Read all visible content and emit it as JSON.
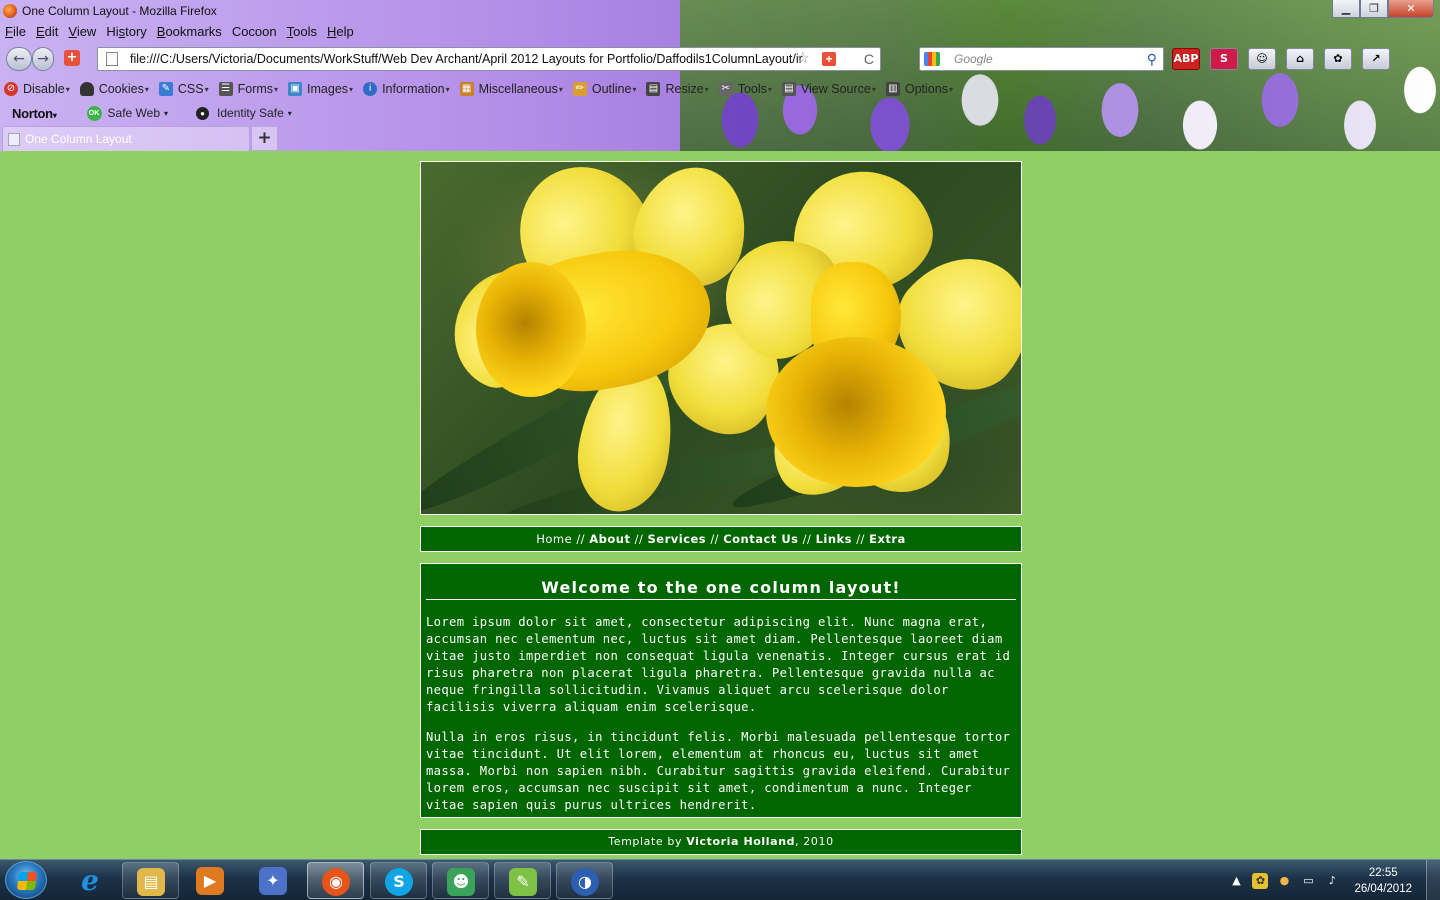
{
  "window": {
    "title": "One Column Layout - Mozilla Firefox",
    "minimize_label": "▁",
    "maximize_label": "❐",
    "close_label": "✕"
  },
  "menubar": {
    "items": [
      {
        "key": "F",
        "rest": "ile"
      },
      {
        "key": "E",
        "rest": "dit"
      },
      {
        "key": "V",
        "rest": "iew"
      },
      {
        "key": "",
        "rest": "Hi",
        "key2": "s",
        "rest2": "tory"
      },
      {
        "key": "B",
        "rest": "ookmarks"
      },
      {
        "key": "",
        "rest": "Cocoon"
      },
      {
        "key": "T",
        "rest": "ools"
      },
      {
        "key": "H",
        "rest": "elp"
      }
    ]
  },
  "navbar": {
    "back_glyph": "←",
    "forward_glyph": "→",
    "url": "file:///C:/Users/Victoria/Documents/WorkStuff/Web Dev Archant/April 2012 Layouts for Portfolio/Daffodils1ColumnLayout/ir",
    "search_placeholder": "Google",
    "star_glyph": "☆",
    "reload_glyph": "C",
    "search_glyph": "⚲",
    "toolbar_icons": [
      "ABP",
      "S",
      "☺",
      "⌂",
      "✿",
      "↗"
    ]
  },
  "webdeveloper_toolbar": {
    "items": [
      {
        "label": "Disable",
        "icon": "disable-icon",
        "color": "#d9342b"
      },
      {
        "label": "Cookies",
        "icon": "cookies-icon",
        "color": "#333333"
      },
      {
        "label": "CSS",
        "icon": "css-icon",
        "color": "#3a7bd5"
      },
      {
        "label": "Forms",
        "icon": "forms-icon",
        "color": "#555555"
      },
      {
        "label": "Images",
        "icon": "images-icon",
        "color": "#3c87c7"
      },
      {
        "label": "Information",
        "icon": "information-icon",
        "color": "#2e6cc6"
      },
      {
        "label": "Miscellaneous",
        "icon": "miscellaneous-icon",
        "color": "#c9822a"
      },
      {
        "label": "Outline",
        "icon": "outline-icon",
        "color": "#d8a030"
      },
      {
        "label": "Resize",
        "icon": "resize-icon",
        "color": "#444444"
      },
      {
        "label": "Tools",
        "icon": "tools-icon",
        "color": "#666666"
      },
      {
        "label": "View Source",
        "icon": "view-source-icon",
        "color": "#555555"
      },
      {
        "label": "Options",
        "icon": "options-icon",
        "color": "#444444"
      }
    ]
  },
  "norton_toolbar": {
    "brand": "Norton",
    "safe_web": "Safe Web",
    "ok_badge": "OK",
    "identity_safe": "Identity Safe"
  },
  "tabs": [
    {
      "label": "One Column Layout"
    }
  ],
  "new_tab_label": "+",
  "page": {
    "nav": {
      "home": "Home",
      "about": "About",
      "services": "Services",
      "contact": "Contact Us",
      "links": "Links",
      "extra": "Extra",
      "separator": "//"
    },
    "heading": "Welcome to the one column layout!",
    "paragraphs": [
      "Lorem ipsum dolor sit amet, consectetur adipiscing elit. Nunc magna erat, accumsan nec elementum nec, luctus sit amet diam. Pellentesque laoreet diam vitae justo imperdiet non consequat ligula venenatis. Integer cursus erat id risus pharetra non placerat ligula pharetra. Pellentesque gravida nulla ac neque fringilla sollicitudin. Vivamus aliquet arcu scelerisque dolor facilisis viverra aliquam enim scelerisque.",
      "Nulla in eros risus, in tincidunt felis. Morbi malesuada pellentesque tortor vitae tincidunt. Ut elit lorem, elementum at rhoncus eu, luctus sit amet massa. Morbi non sapien nibh. Curabitur sagittis gravida eleifend. Curabitur lorem eros, accumsan nec suscipit sit amet, condimentum a nunc. Integer vitae sapien quis purus ultrices hendrerit."
    ],
    "footer": {
      "prefix": "Template by",
      "author": "Victoria Holland",
      "suffix": ", 2010"
    }
  },
  "taskbar": {
    "apps": [
      {
        "name": "internet-explorer",
        "glyph": "e",
        "color": "#1f8fe0"
      },
      {
        "name": "windows-explorer",
        "glyph": "▤",
        "color": "#e1b84a"
      },
      {
        "name": "media-player",
        "glyph": "▶",
        "color": "#e07a20"
      },
      {
        "name": "jetaudio",
        "glyph": "✦",
        "color": "#4b72c8"
      },
      {
        "name": "firefox",
        "glyph": "◉",
        "color": "#e5541b"
      },
      {
        "name": "skype",
        "glyph": "S",
        "color": "#12a5e6"
      },
      {
        "name": "messenger",
        "glyph": "☻",
        "color": "#3aa35a"
      },
      {
        "name": "notepad",
        "glyph": "✎",
        "color": "#7dc245"
      },
      {
        "name": "globe-app",
        "glyph": "◑",
        "color": "#2c5fb0"
      }
    ],
    "tray_icons": [
      "▲",
      "✿",
      "●",
      "▭",
      "♪"
    ],
    "time": "22:55",
    "date": "26/04/2012"
  }
}
